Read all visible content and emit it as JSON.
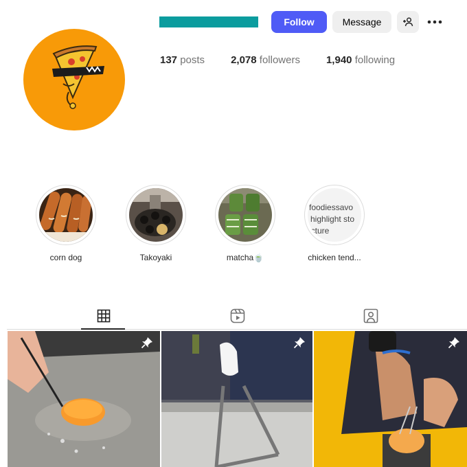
{
  "colors": {
    "accent": "#4F5BF6",
    "username_redaction": "#0B9C9E",
    "avatar_bg": "#F89A08"
  },
  "header": {
    "follow_label": "Follow",
    "message_label": "Message",
    "add_user_icon": "person-plus-icon",
    "more_icon": "ellipsis-icon"
  },
  "stats": {
    "posts_count": "137",
    "posts_label": "posts",
    "followers_count": "2,078",
    "followers_label": "followers",
    "following_count": "1,940",
    "following_label": "following"
  },
  "highlights": [
    {
      "label": "corn dog"
    },
    {
      "label": "Takoyaki"
    },
    {
      "label": "matcha🍵"
    },
    {
      "label": "chicken tend...",
      "broken_alt": [
        "foodiessavo",
        "highlight sto",
        "icture"
      ]
    }
  ],
  "tabs": [
    {
      "name": "posts",
      "icon": "grid-icon",
      "active": true
    },
    {
      "name": "reels",
      "icon": "reels-icon",
      "active": false
    },
    {
      "name": "tagged",
      "icon": "tagged-icon",
      "active": false
    }
  ],
  "posts": [
    {
      "pinned": true,
      "icon": "pin-icon"
    },
    {
      "pinned": true,
      "icon": "pin-icon"
    },
    {
      "pinned": true,
      "icon": "pin-icon"
    }
  ]
}
